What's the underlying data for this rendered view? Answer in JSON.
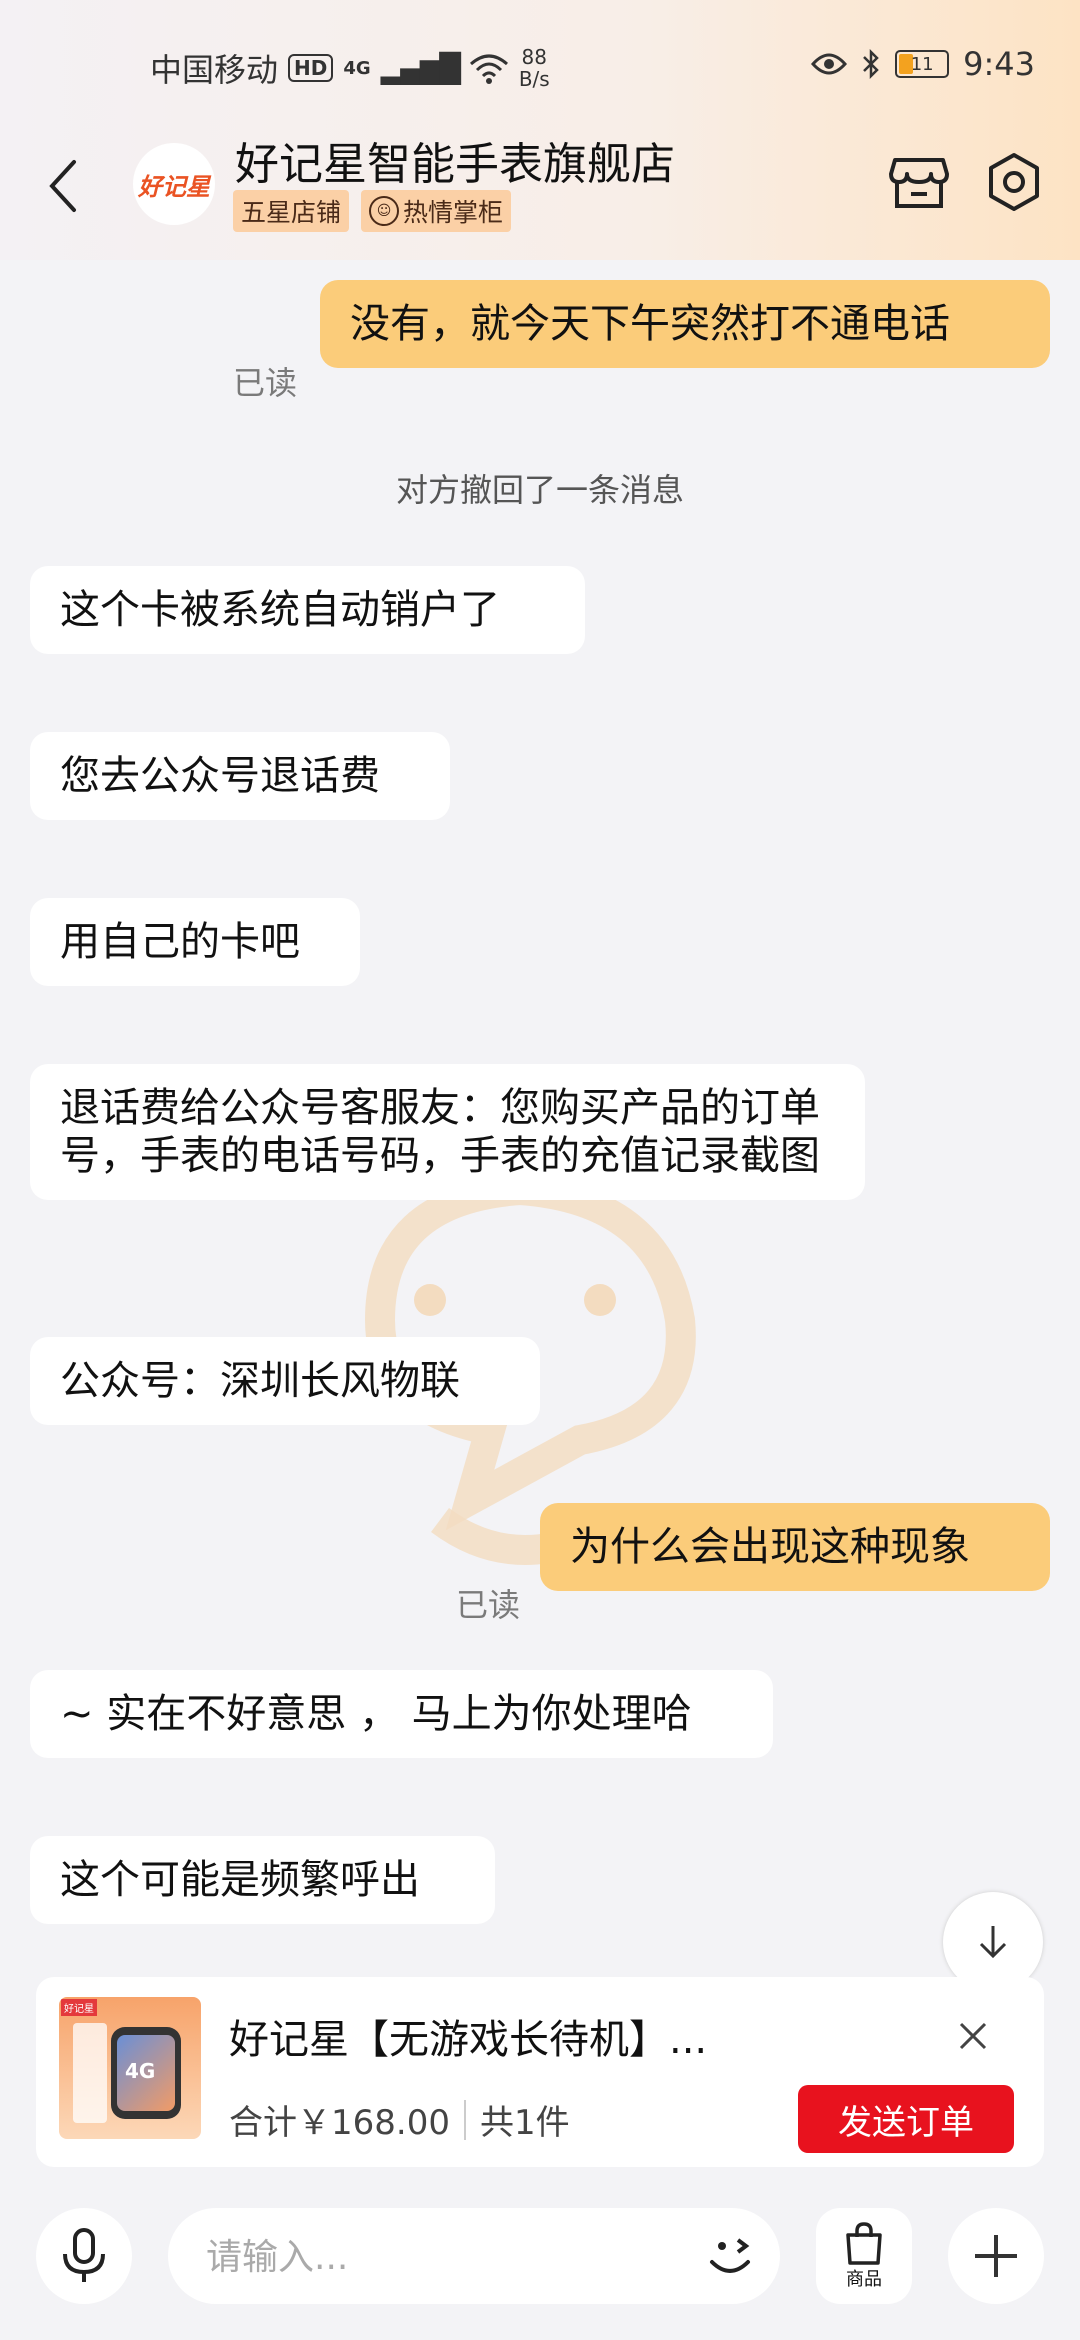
{
  "status_bar": {
    "carrier": "中国移动",
    "hd": "HD",
    "network": "4G",
    "speed_value": "88",
    "speed_unit": "B/s",
    "battery": "11",
    "time": "9:43"
  },
  "header": {
    "logo_text": "好记星",
    "shop_name": "好记星智能手表旗舰店",
    "tags": [
      "五星店铺",
      "热情掌柜"
    ]
  },
  "messages": [
    {
      "dir": "out",
      "text": "没有，就今天下午突然打不通电话",
      "read": "已读"
    },
    {
      "dir": "in",
      "text": "这个卡被系统自动销户了"
    },
    {
      "dir": "in",
      "text": "您去公众号退话费"
    },
    {
      "dir": "in",
      "text": "用自己的卡吧"
    },
    {
      "dir": "in",
      "text": "退话费给公众号客服友：您购买产品的订单号，手表的电话号码，手表的充值记录截图"
    },
    {
      "dir": "in",
      "text": "公众号：深圳长风物联"
    },
    {
      "dir": "out",
      "text": "为什么会出现这种现象",
      "read": "已读"
    },
    {
      "dir": "in",
      "text": "~ 实在不好意思 ， 马上为你处理哈"
    },
    {
      "dir": "in",
      "text": "这个可能是频繁呼出"
    }
  ],
  "system_note": "对方撤回了一条消息",
  "order_card": {
    "thumb_stamp": "好记星",
    "thumb_badge": "4G",
    "title": "好记星【无游戏长待机】...",
    "total_label": "合计￥168.00",
    "count_label": "共1件",
    "send_button": "发送订单"
  },
  "input_bar": {
    "placeholder": "请输入...",
    "goods_label": "商品"
  },
  "colors": {
    "incoming_bubble": "#ffffff",
    "outgoing_bubble": "#fbcc7a",
    "send_order": "#e8121e",
    "tag_bg": "#fbd0a6"
  }
}
